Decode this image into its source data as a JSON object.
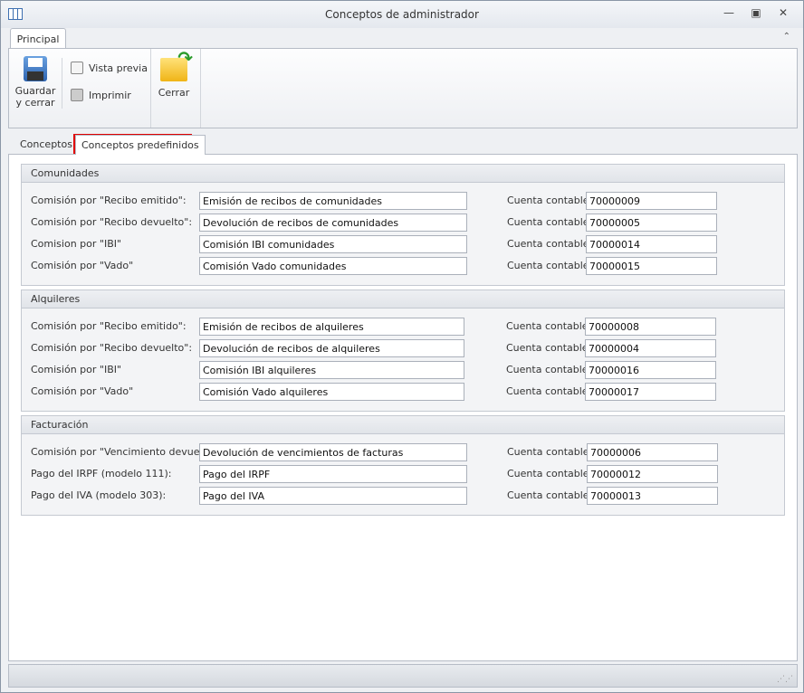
{
  "window": {
    "title": "Conceptos de administrador"
  },
  "ribbon": {
    "tab": "Principal",
    "save_label_1": "Guardar",
    "save_label_2": "y cerrar",
    "preview_label": "Vista previa",
    "print_label": "Imprimir",
    "close_label": "Cerrar"
  },
  "tabs": [
    {
      "label": "Conceptos"
    },
    {
      "label": "Conceptos predefinidos"
    }
  ],
  "account_label": "Cuenta contable:",
  "groups": [
    {
      "title": "Comunidades",
      "rows": [
        {
          "label": "Comisión por \"Recibo emitido\":",
          "value": "Emisión de recibos de comunidades",
          "account": "70000009"
        },
        {
          "label": "Comisión por \"Recibo devuelto\":",
          "value": "Devolución de recibos de comunidades",
          "account": "70000005"
        },
        {
          "label": "Comision por \"IBI\"",
          "value": "Comisión IBI comunidades",
          "account": "70000014"
        },
        {
          "label": "Comisión por \"Vado\"",
          "value": "Comisión Vado comunidades",
          "account": "70000015"
        }
      ]
    },
    {
      "title": "Alquileres",
      "rows": [
        {
          "label": "Comisión por \"Recibo emitido\":",
          "value": "Emisión de recibos de alquileres",
          "account": "70000008"
        },
        {
          "label": "Comisión por \"Recibo devuelto\":",
          "value": "Devolución de recibos de alquileres",
          "account": "70000004"
        },
        {
          "label": "Comisión por \"IBI\"",
          "value": "Comisión IBI alquileres",
          "account": "70000016"
        },
        {
          "label": "Comisión por \"Vado\"",
          "value": "Comisión Vado alquileres",
          "account": "70000017"
        }
      ]
    },
    {
      "title": "Facturación",
      "rows": [
        {
          "label": "Comisión por \"Vencimiento devuelto\":",
          "value": "Devolución de vencimientos de facturas",
          "account": "70000006"
        },
        {
          "label": "Pago del IRPF (modelo 111):",
          "value": "Pago del IRPF",
          "account": "70000012"
        },
        {
          "label": "Pago del IVA (modelo 303):",
          "value": "Pago del IVA",
          "account": "70000013"
        }
      ]
    }
  ]
}
